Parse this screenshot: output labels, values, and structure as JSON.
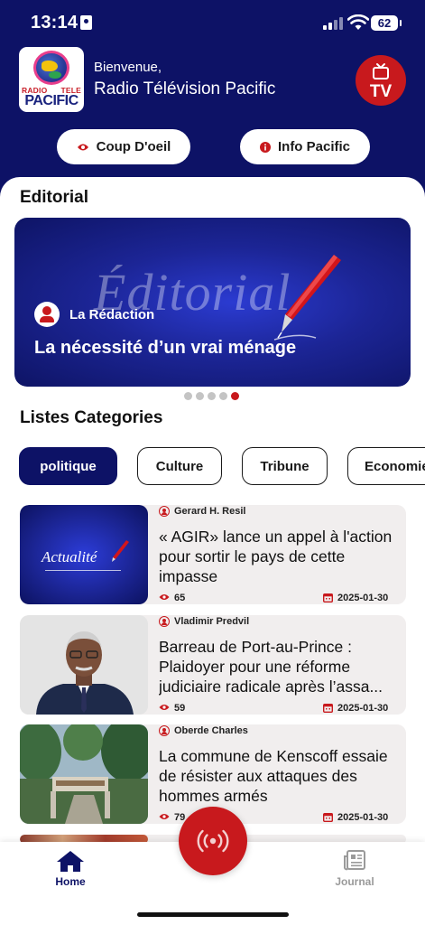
{
  "status_bar": {
    "time": "13:14",
    "battery": "62"
  },
  "header": {
    "logo": {
      "line1_left": "RADIO",
      "line1_right": "TELE",
      "line2": "PACIFIC"
    },
    "greeting": "Bienvenue,",
    "station_name": "Radio Télévision Pacific",
    "tv_button_label": "TV",
    "coup_doeil_label": "Coup D'oeil",
    "info_pacific_label": "Info Pacific"
  },
  "editorial": {
    "section_title": "Editorial",
    "banner_word": "Éditorial",
    "author": "La Rédaction",
    "title": "La nécessité d’un vrai ménage",
    "carousel_count": 5,
    "carousel_active_index": 4
  },
  "categories": {
    "section_title": "Listes Categories",
    "items": [
      "politique",
      "Culture",
      "Tribune",
      "Economie"
    ],
    "active": "politique"
  },
  "articles": [
    {
      "thumb_text": "Actualité",
      "author": "Gerard H. Resil",
      "title": "« AGIR» lance un appel à l'action pour sortir le pays de cette impasse",
      "views": "65",
      "date": "2025-01-30"
    },
    {
      "thumb_text": "",
      "author": "Vladimir Predvil",
      "title": "Barreau de Port-au-Prince : Plaidoyer pour une réforme judiciaire radicale après l’assa...",
      "views": "59",
      "date": "2025-01-30"
    },
    {
      "thumb_text": "",
      "author": "Oberde Charles",
      "title": "La commune de Kenscoff essaie de résister aux attaques des hommes armés",
      "views": "79",
      "date": "2025-01-30"
    }
  ],
  "bottom_nav": {
    "home_label": "Home",
    "journal_label": "Journal"
  },
  "colors": {
    "primary": "#0d1266",
    "accent": "#c8191d",
    "card_bg": "#f1eeee"
  }
}
